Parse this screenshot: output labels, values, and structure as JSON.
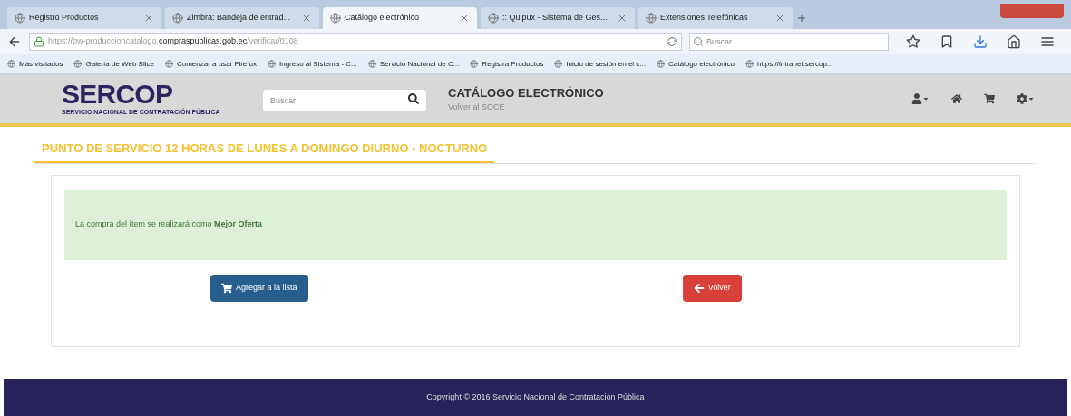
{
  "browser": {
    "tabs": [
      {
        "label": "Registro Productos",
        "selected": false
      },
      {
        "label": "Zimbra: Bandeja de entrad...",
        "selected": false
      },
      {
        "label": "Catálogo electrónico",
        "selected": true
      },
      {
        "label": ":: Quipux - Sistema de Ges...",
        "selected": false
      },
      {
        "label": "Extensiones Telefónicas",
        "selected": false
      }
    ],
    "url": {
      "prefix": "https://pw-produccioncatalogo.",
      "domain": "compraspublicas.gob.ec",
      "suffix": "/verificar/0108"
    },
    "search": {
      "placeholder": "Buscar"
    },
    "bookmarks": [
      "Más visitados",
      "Galería de Web Slice",
      "Comenzar a usar Firefox",
      "Ingreso al Sistema - C...",
      "Servicio Nacional de C...",
      "Registra Productos",
      "Inicio de sesión en el c...",
      "Catálogo electrónico",
      "https://intranet.sercop..."
    ]
  },
  "header": {
    "logo": "SERCOP",
    "logo_subtitle": "SERVICIO NACIONAL DE CONTRATACIÓN PÚBLICA",
    "search": {
      "placeholder": "Buscar"
    },
    "title": "CATÁLOGO ELECTRÓNICO",
    "back_link": "Volver al SOCE"
  },
  "page_title": "PUNTO DE SERVICIO 12 HORAS DE LUNES A DOMINGO DIURNO - NOCTURNO",
  "alert": "La compra del ítem se realizará como **Mejor Oferta**",
  "buttons": [
    {
      "kind": "add",
      "label": "Agregar a la lista"
    },
    {
      "kind": "back",
      "label": "Volver"
    }
  ],
  "footer": "Copyright © 2016 Servicio Nacional de Contratación Pública"
}
